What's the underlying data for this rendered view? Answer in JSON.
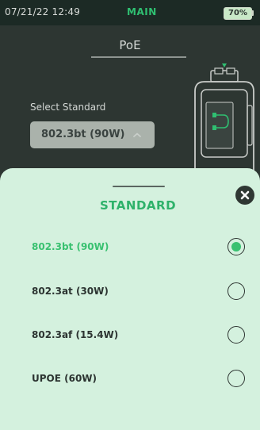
{
  "status_bar": {
    "datetime": "07/21/22 12:49",
    "mode": "MAIN",
    "battery": "70%"
  },
  "page": {
    "title": "PoE",
    "select_label": "Select Standard",
    "selected_value": "802.3bt (90W)"
  },
  "sheet": {
    "title": "STANDARD",
    "options": [
      {
        "label": "802.3bt (90W)",
        "selected": true
      },
      {
        "label": "802.3at (30W)",
        "selected": false
      },
      {
        "label": "802.3af (15.4W)",
        "selected": false
      },
      {
        "label": "UPOE (60W)",
        "selected": false
      }
    ]
  },
  "colors": {
    "accent": "#39c170",
    "sheet_background": "#d4f1de",
    "screen_background": "#2d3632"
  },
  "icons": {
    "close": "close-icon",
    "dropdown": "chevron-up-icon",
    "device": "device-icon"
  }
}
